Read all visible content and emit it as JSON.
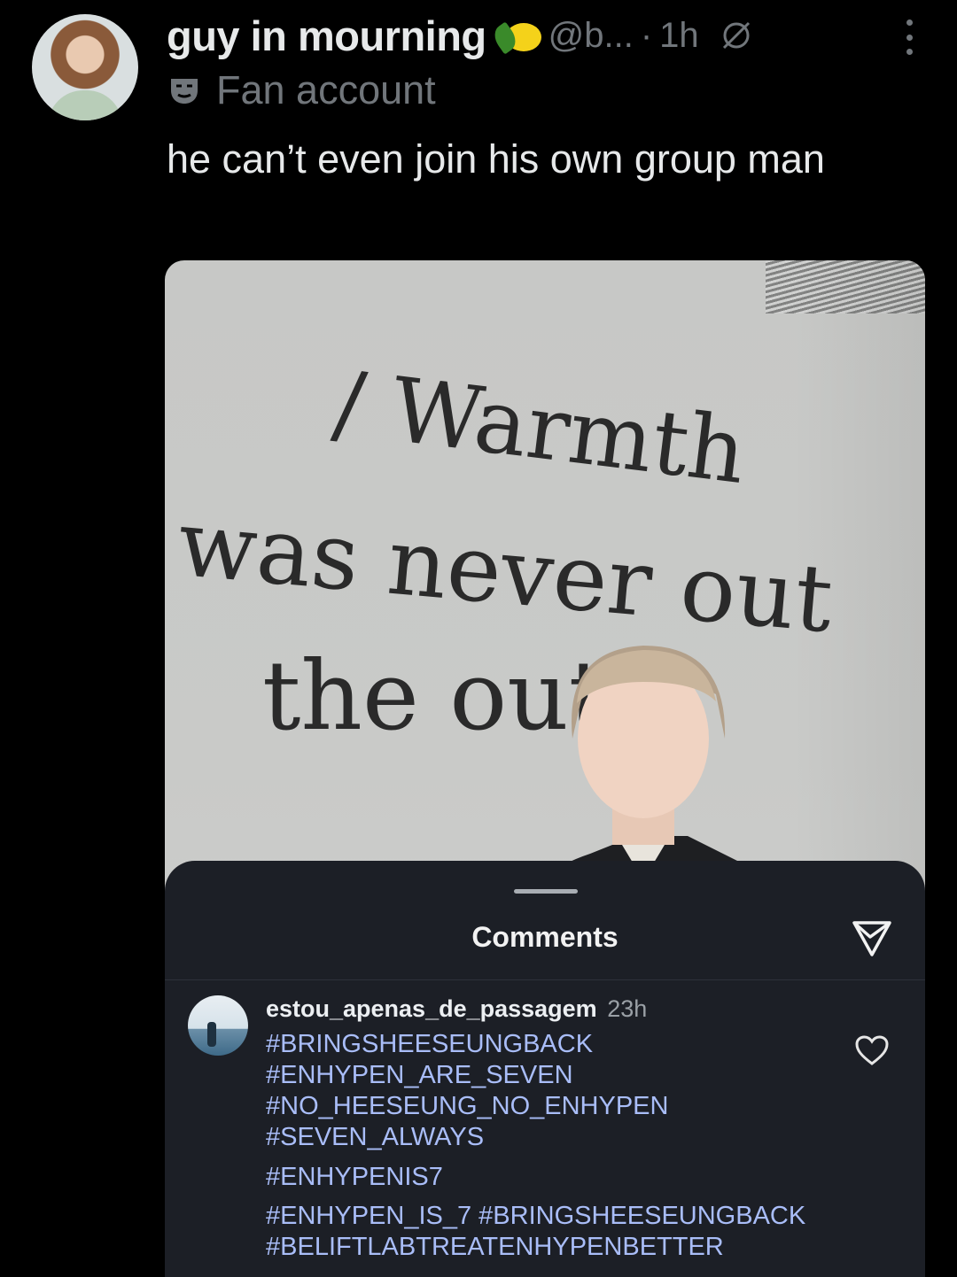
{
  "tweet": {
    "display_name": "guy in mourning",
    "handle": "@b...",
    "separator": "·",
    "time": "1h",
    "account_label": "Fan account",
    "text": "he can’t even join his own group man",
    "icons": [
      "lemon-emoji",
      "null-symbol-icon",
      "more-options-icon",
      "mask-icon"
    ]
  },
  "photo": {
    "wall_text_line1": "/ Warmth",
    "wall_text_line2": "was never out",
    "wall_text_line3": "the out"
  },
  "comments_sheet": {
    "title": "Comments",
    "comment": {
      "username": "estou_apenas_de_passagem",
      "time": "23h",
      "hashtags": [
        "#BRINGSHEESEUNGBACK",
        "#ENHYPEN_ARE_SEVEN",
        "#NO_HEESEUNG_NO_ENHYPEN",
        "#SEVEN_ALWAYS",
        "#ENHYPENIS7",
        "#ENHYPEN_IS_7 #BRINGSHEESEUNGBACK",
        "#BELIFTLABTREATENHYPENBETTER"
      ]
    },
    "icons": [
      "send-icon",
      "heart-icon"
    ]
  },
  "colors": {
    "background": "#000000",
    "muted": "#71767b",
    "hashtag": "#a9bdf8",
    "sheet": "#1c1f26"
  }
}
